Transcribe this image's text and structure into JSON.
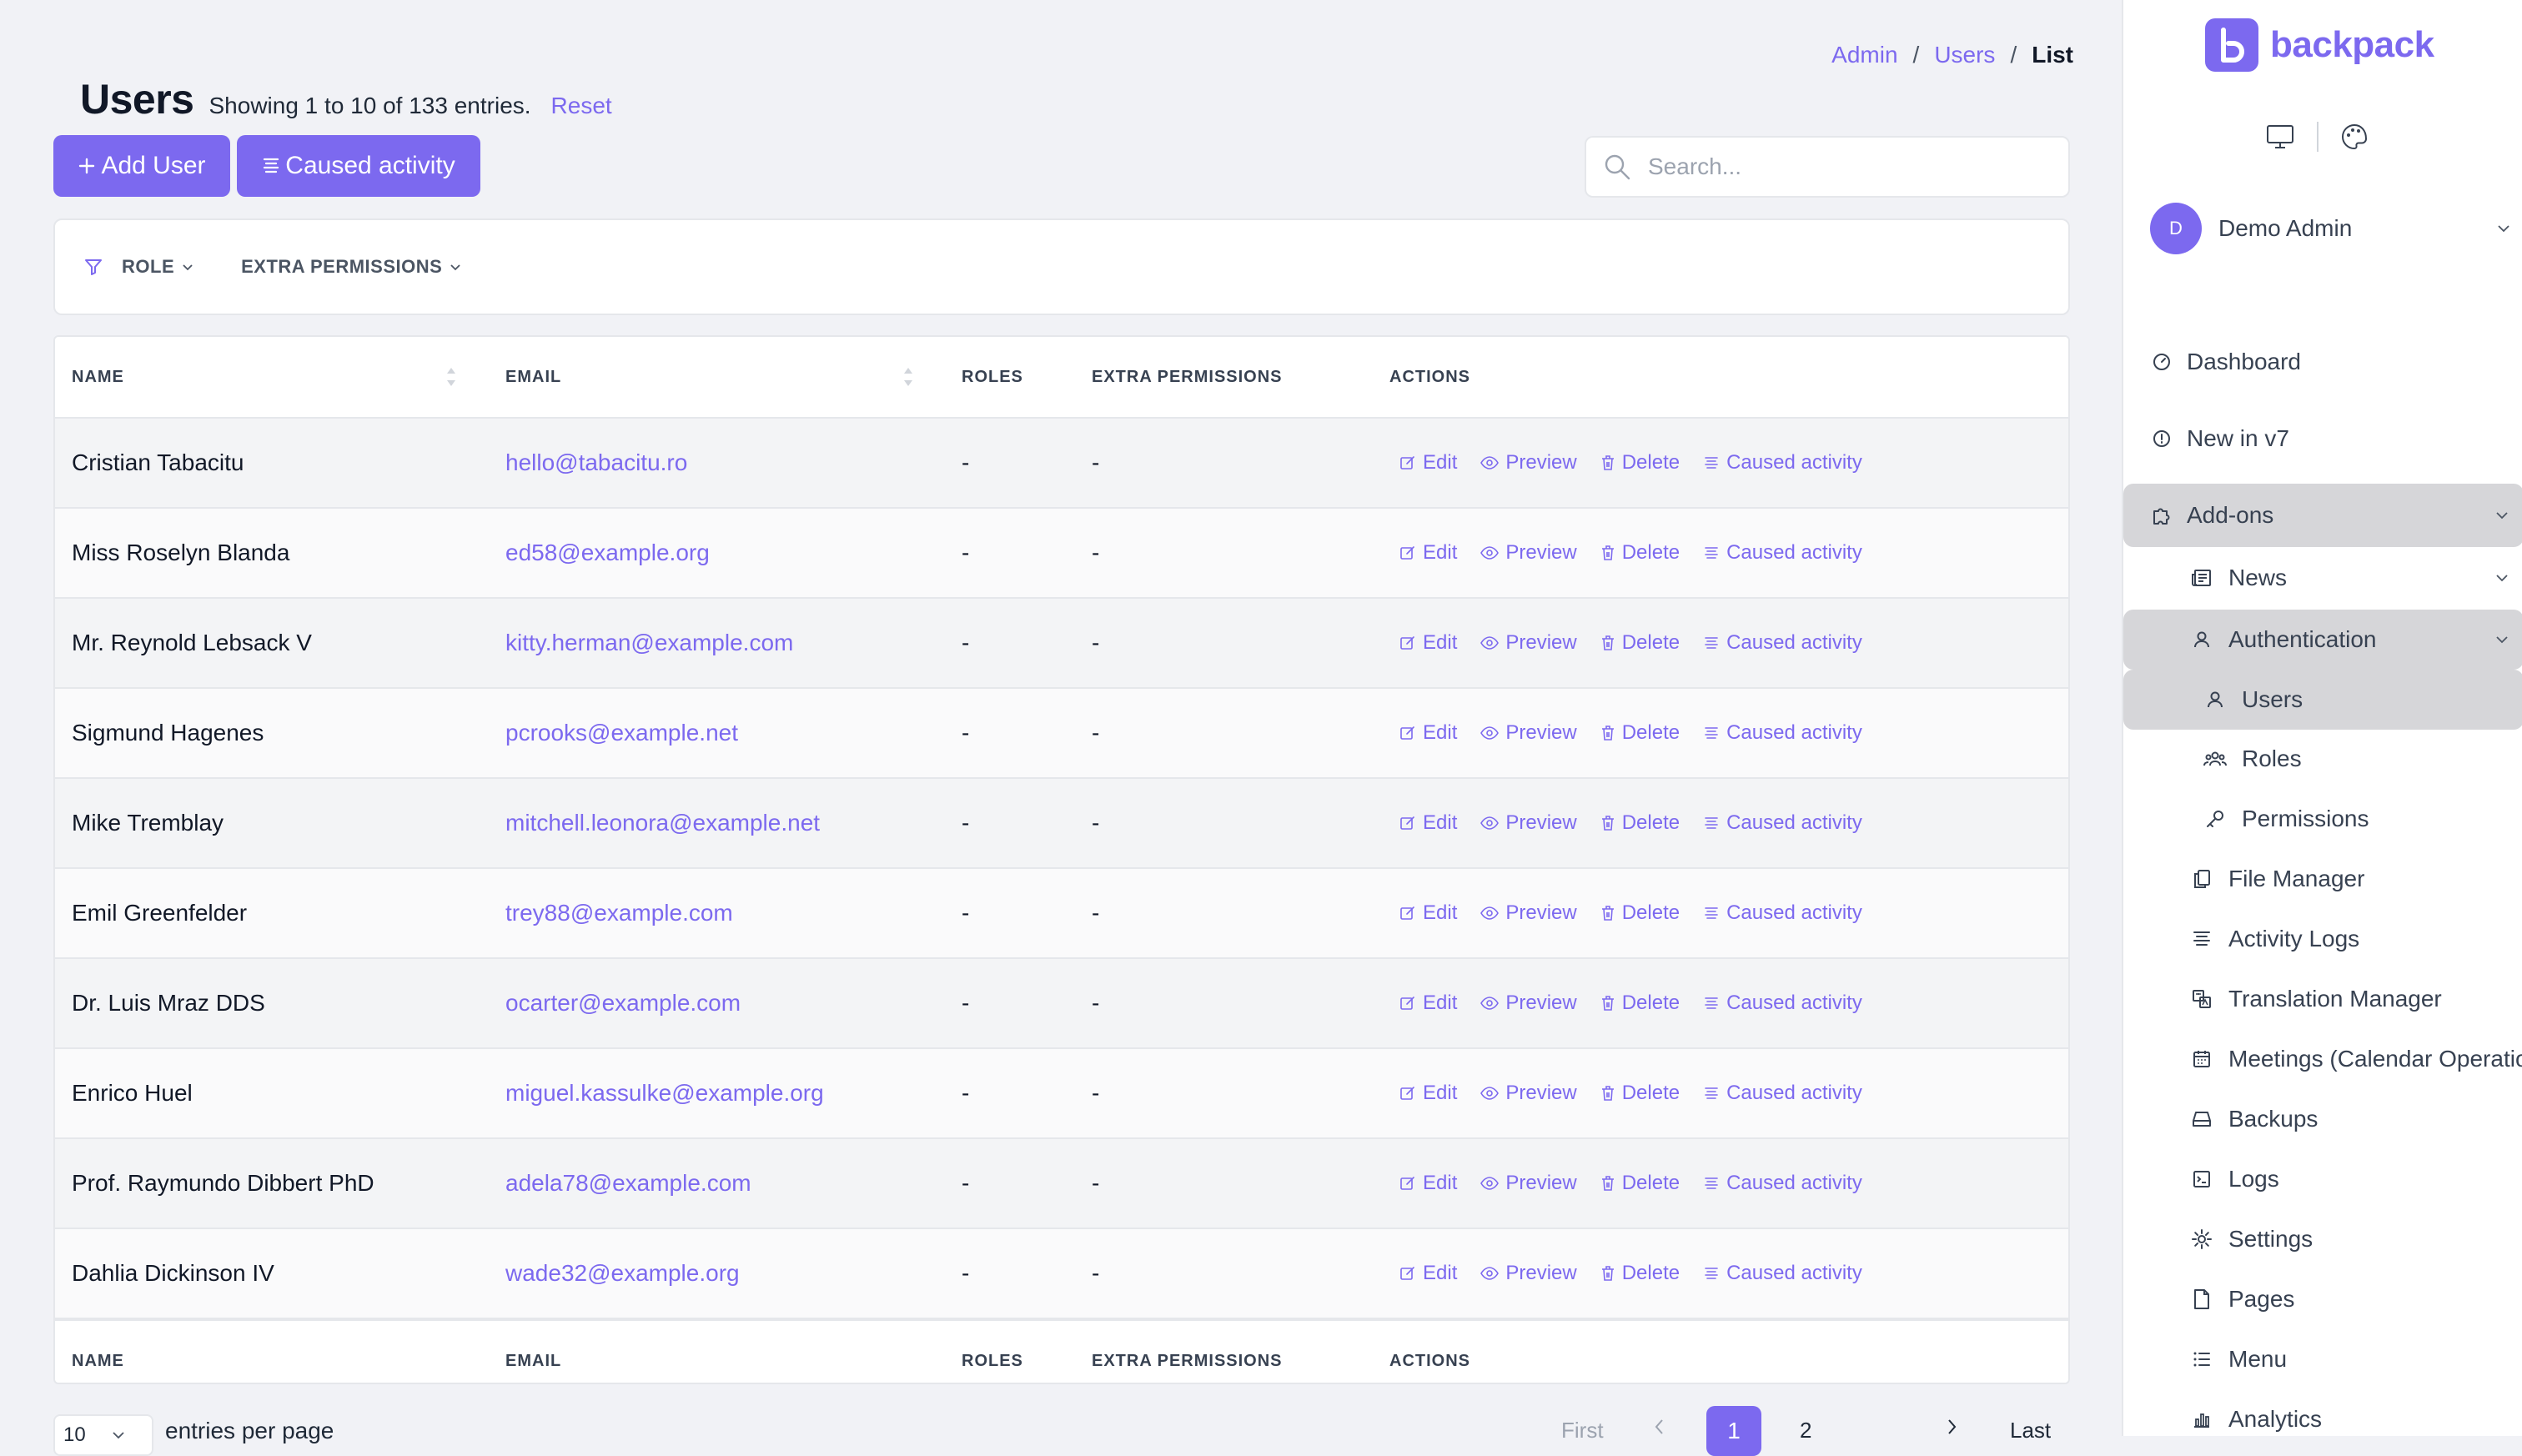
{
  "breadcrumb": {
    "items": [
      "Admin",
      "Users"
    ],
    "current": "List"
  },
  "header": {
    "title": "Users",
    "entries_info": "Showing 1 to 10 of 133 entries.",
    "reset_label": "Reset"
  },
  "toolbar": {
    "add_label": "Add User",
    "activity_label": "Caused activity"
  },
  "search": {
    "placeholder": "Search...",
    "value": ""
  },
  "filters": {
    "items": [
      "ROLE",
      "EXTRA PERMISSIONS"
    ]
  },
  "table": {
    "columns": [
      "NAME",
      "EMAIL",
      "ROLES",
      "EXTRA PERMISSIONS",
      "ACTIONS"
    ],
    "action_labels": {
      "edit": "Edit",
      "preview": "Preview",
      "delete": "Delete",
      "activity": "Caused activity"
    },
    "rows": [
      {
        "name": "Cristian Tabacitu",
        "email": "hello@tabacitu.ro",
        "roles": "-",
        "extra_permissions": "-"
      },
      {
        "name": "Miss Roselyn Blanda",
        "email": "ed58@example.org",
        "roles": "-",
        "extra_permissions": "-"
      },
      {
        "name": "Mr. Reynold Lebsack V",
        "email": "kitty.herman@example.com",
        "roles": "-",
        "extra_permissions": "-"
      },
      {
        "name": "Sigmund Hagenes",
        "email": "pcrooks@example.net",
        "roles": "-",
        "extra_permissions": "-"
      },
      {
        "name": "Mike Tremblay",
        "email": "mitchell.leonora@example.net",
        "roles": "-",
        "extra_permissions": "-"
      },
      {
        "name": "Emil Greenfelder",
        "email": "trey88@example.com",
        "roles": "-",
        "extra_permissions": "-"
      },
      {
        "name": "Dr. Luis Mraz DDS",
        "email": "ocarter@example.com",
        "roles": "-",
        "extra_permissions": "-"
      },
      {
        "name": "Enrico Huel",
        "email": "miguel.kassulke@example.org",
        "roles": "-",
        "extra_permissions": "-"
      },
      {
        "name": "Prof. Raymundo Dibbert PhD",
        "email": "adela78@example.com",
        "roles": "-",
        "extra_permissions": "-"
      },
      {
        "name": "Dahlia Dickinson IV",
        "email": "wade32@example.org",
        "roles": "-",
        "extra_permissions": "-"
      }
    ]
  },
  "footer": {
    "per_page_value": "10",
    "per_page_label": "entries per page",
    "pagination": {
      "first": "First",
      "last": "Last",
      "pages": [
        "1",
        "2"
      ],
      "current": "1"
    }
  },
  "sidebar": {
    "brand": "backpack",
    "user": {
      "name": "Demo Admin",
      "initial": "D"
    },
    "nav": {
      "dashboard": "Dashboard",
      "new_in_v7": "New in v7",
      "addons": "Add-ons",
      "news": "News",
      "authentication": "Authentication",
      "users": "Users",
      "roles": "Roles",
      "permissions": "Permissions",
      "file_manager": "File Manager",
      "activity_logs": "Activity Logs",
      "translation_manager": "Translation Manager",
      "meetings": "Meetings (Calendar Operation)",
      "backups": "Backups",
      "logs": "Logs",
      "settings": "Settings",
      "pages": "Pages",
      "menu": "Menu",
      "analytics": "Analytics"
    }
  },
  "colors": {
    "accent": "#7c69ef",
    "background": "#f1f2f6",
    "row_alt": "#f3f4f6",
    "highlight": "#d6d6d9"
  }
}
